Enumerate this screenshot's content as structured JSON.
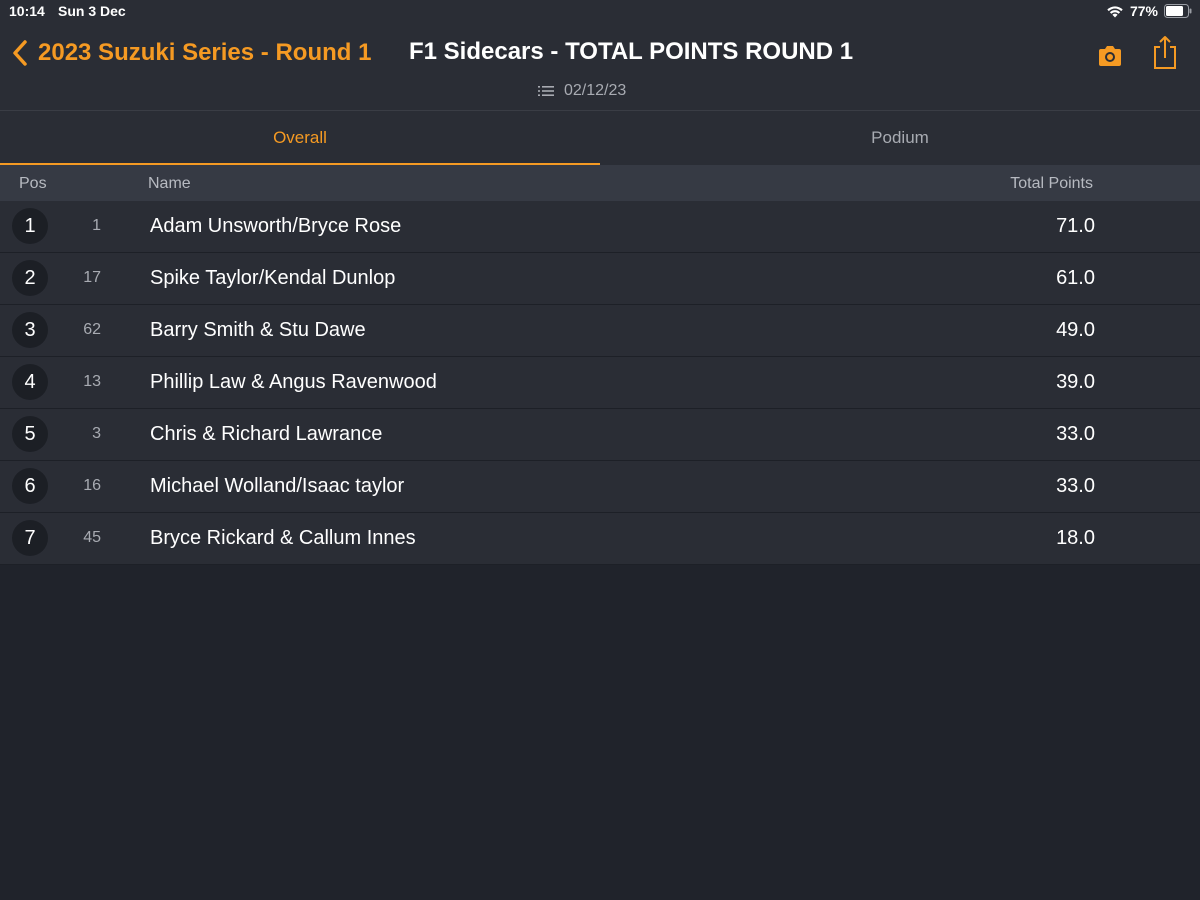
{
  "status_bar": {
    "time": "10:14",
    "date": "Sun 3 Dec",
    "battery": "77%"
  },
  "nav": {
    "back_label": "2023 Suzuki Series - Round 1",
    "title": "F1 Sidecars - TOTAL POINTS ROUND 1",
    "date": "02/12/23"
  },
  "tabs": [
    {
      "label": "Overall",
      "active": true
    },
    {
      "label": "Podium",
      "active": false
    }
  ],
  "columns": {
    "pos": "Pos",
    "name": "Name",
    "points": "Total Points"
  },
  "rows": [
    {
      "pos": "1",
      "num": "1",
      "name": "Adam Unsworth/Bryce Rose",
      "points": "71.0"
    },
    {
      "pos": "2",
      "num": "17",
      "name": "Spike Taylor/Kendal Dunlop",
      "points": "61.0"
    },
    {
      "pos": "3",
      "num": "62",
      "name": "Barry Smith & Stu Dawe",
      "points": "49.0"
    },
    {
      "pos": "4",
      "num": "13",
      "name": "Phillip Law & Angus Ravenwood",
      "points": "39.0"
    },
    {
      "pos": "5",
      "num": "3",
      "name": "Chris & Richard Lawrance",
      "points": "33.0"
    },
    {
      "pos": "6",
      "num": "16",
      "name": "Michael Wolland/Isaac taylor",
      "points": "33.0"
    },
    {
      "pos": "7",
      "num": "45",
      "name": "Bryce Rickard & Callum Innes",
      "points": "18.0"
    }
  ],
  "colors": {
    "accent": "#f59a23",
    "background": "#20232b",
    "row": "#2a2d35"
  },
  "icons": [
    "wifi-icon",
    "battery-icon",
    "chevron-left-icon",
    "list-icon",
    "camera-icon",
    "share-icon"
  ]
}
